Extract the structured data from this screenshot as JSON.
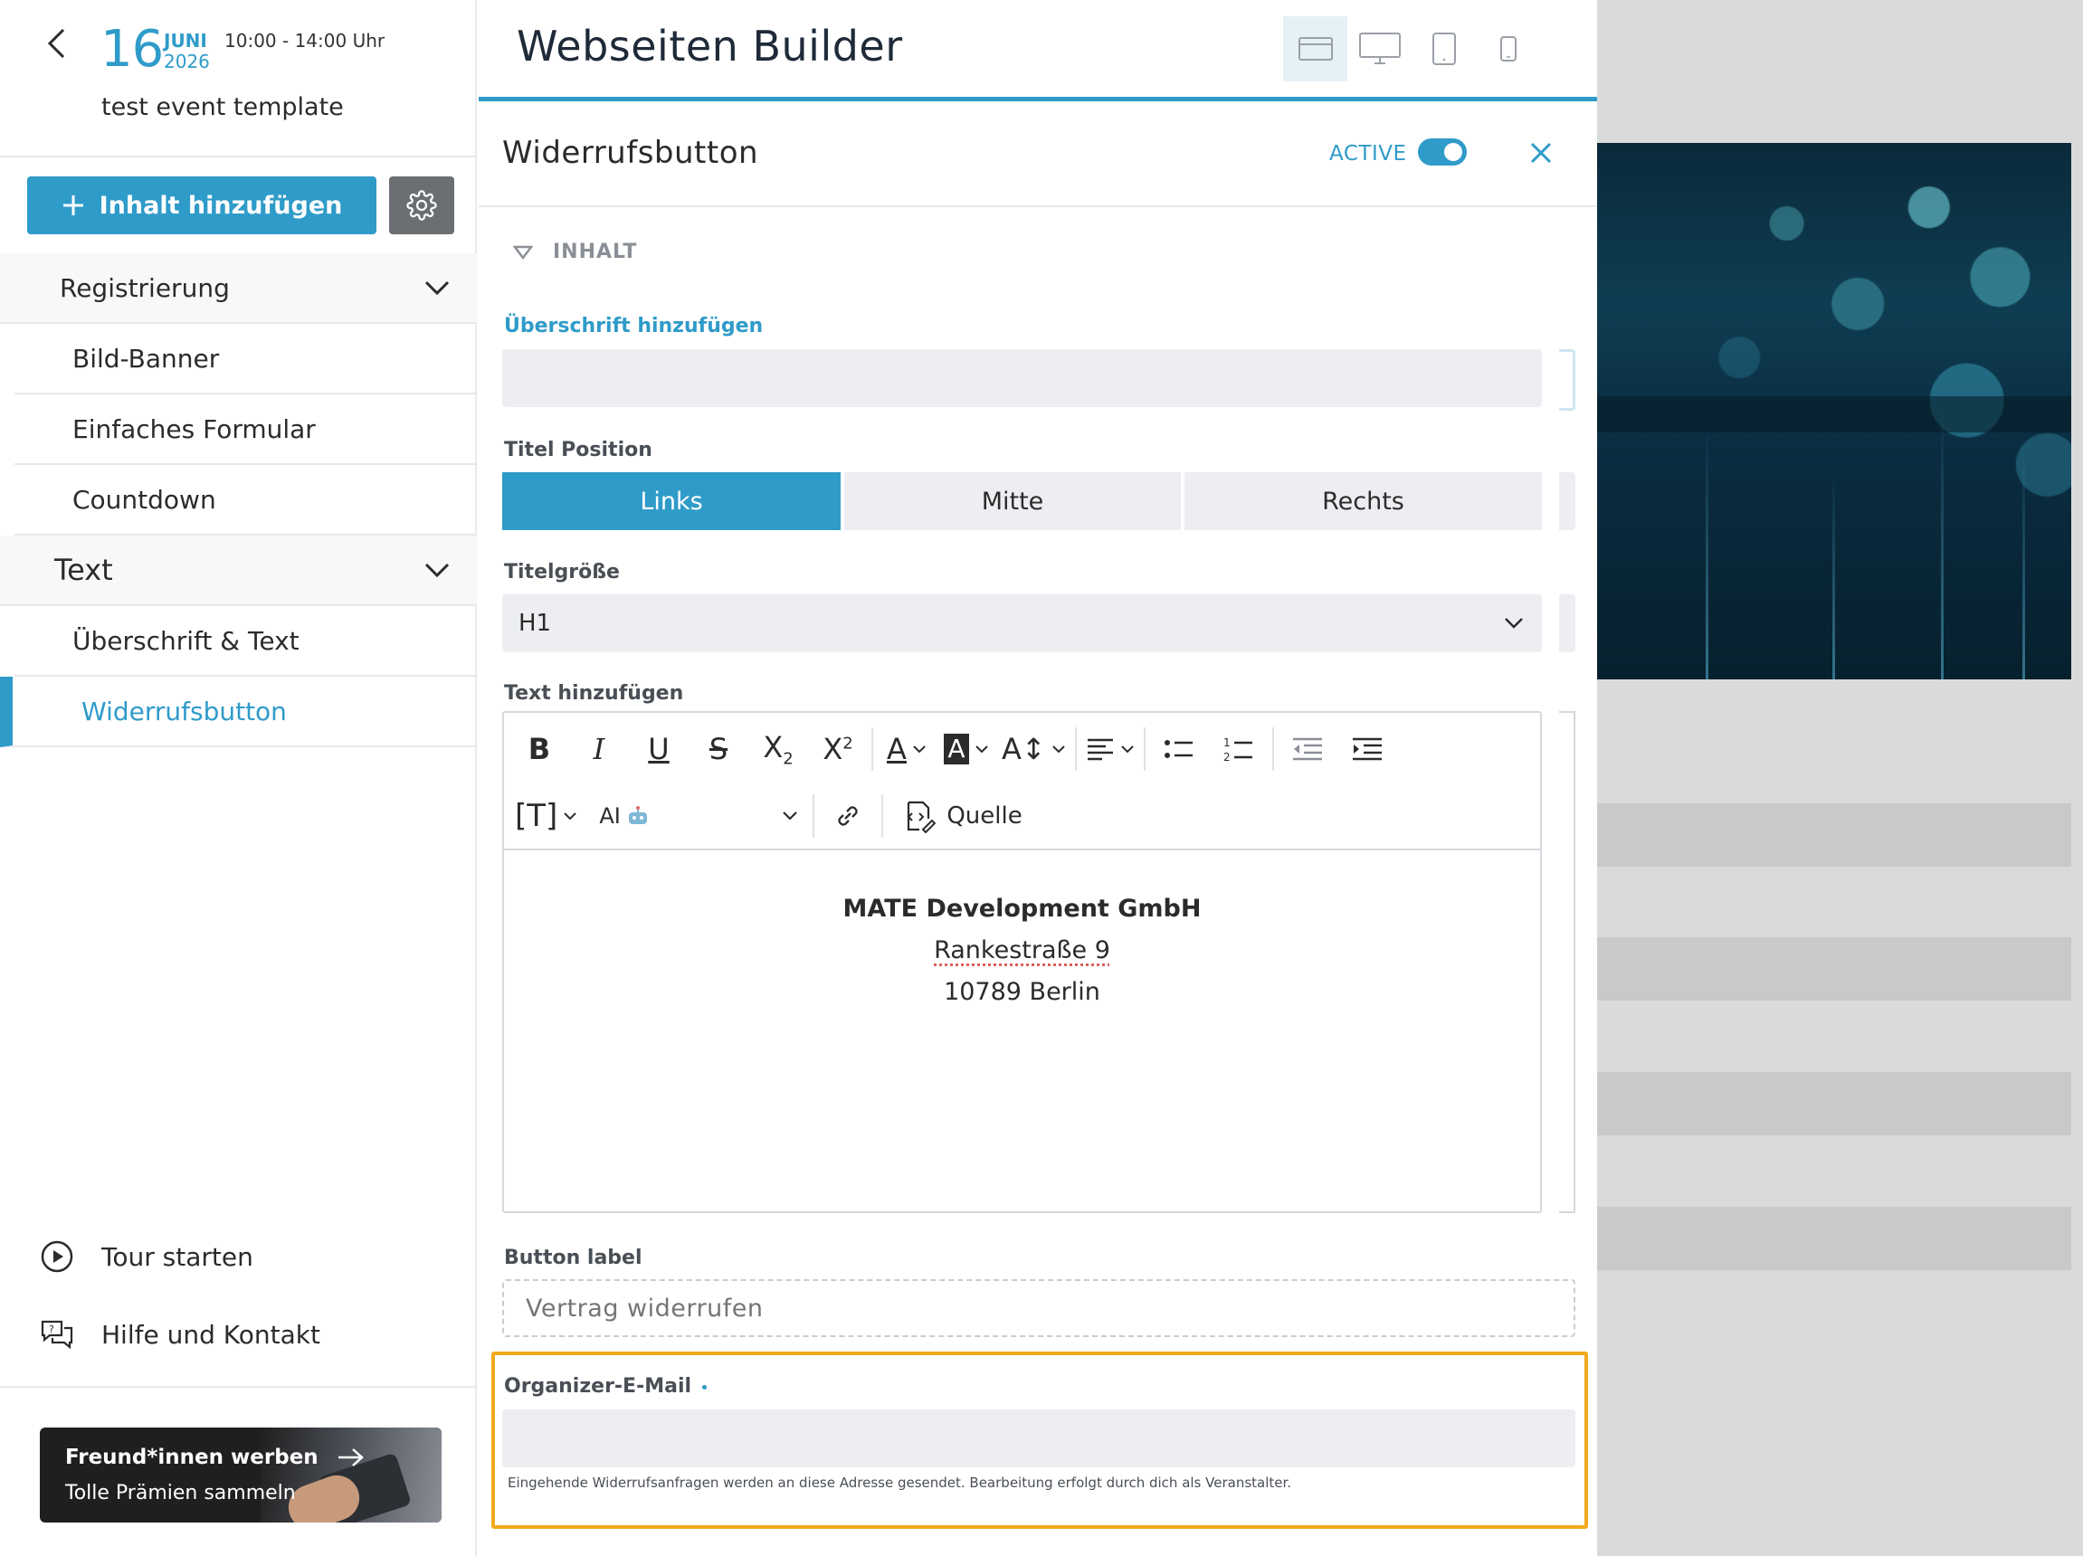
{
  "event": {
    "day": "16",
    "month": "JUNI",
    "year": "2026",
    "time": "10:00 - 14:00 Uhr",
    "title": "test event template"
  },
  "sidebar": {
    "add_content_label": "Inhalt hinzufügen",
    "groups": [
      {
        "label": "Registrierung",
        "items": [
          "Bild-Banner",
          "Einfaches Formular",
          "Countdown"
        ]
      },
      {
        "label": "Text",
        "items": [
          "Überschrift & Text",
          "Widerrufsbutton"
        ]
      }
    ],
    "active_item": "Widerrufsbutton",
    "footer": {
      "tour": "Tour starten",
      "help": "Hilfe und Kontakt"
    },
    "promo": {
      "title": "Freund*innen werben",
      "subtitle": "Tolle Prämien sammeln"
    }
  },
  "main": {
    "title": "Webseiten Builder",
    "devices": [
      "layout-icon",
      "desktop-icon",
      "tablet-icon",
      "mobile-icon"
    ],
    "active_device": "layout-icon"
  },
  "panel": {
    "title": "Widerrufsbutton",
    "active_label": "ACTIVE",
    "active": true,
    "section": "INHALT",
    "heading_label": "Überschrift hinzufügen",
    "heading_value": "",
    "title_position_label": "Titel Position",
    "title_positions": [
      "Links",
      "Mitte",
      "Rechts"
    ],
    "title_position_selected": "Links",
    "title_size_label": "Titelgröße",
    "title_size_value": "H1",
    "text_label": "Text hinzufügen",
    "toolbar": {
      "ai_label": "AI",
      "source_label": "Quelle"
    },
    "text_lines": [
      "MATE Development GmbH",
      "Rankestraße 9",
      "10789 Berlin"
    ],
    "button_label_label": "Button label",
    "button_label_placeholder": "Vertrag widerrufen",
    "email_label": "Organizer-E-Mail",
    "email_value": "",
    "email_helper": "Eingehende Widerrufsanfragen werden an diese Adresse gesendet. Bearbeitung erfolgt durch dich als Veranstalter."
  },
  "colors": {
    "accent": "#2f9bc9",
    "highlight": "#f2a91c",
    "field_bg": "#eceef1"
  }
}
